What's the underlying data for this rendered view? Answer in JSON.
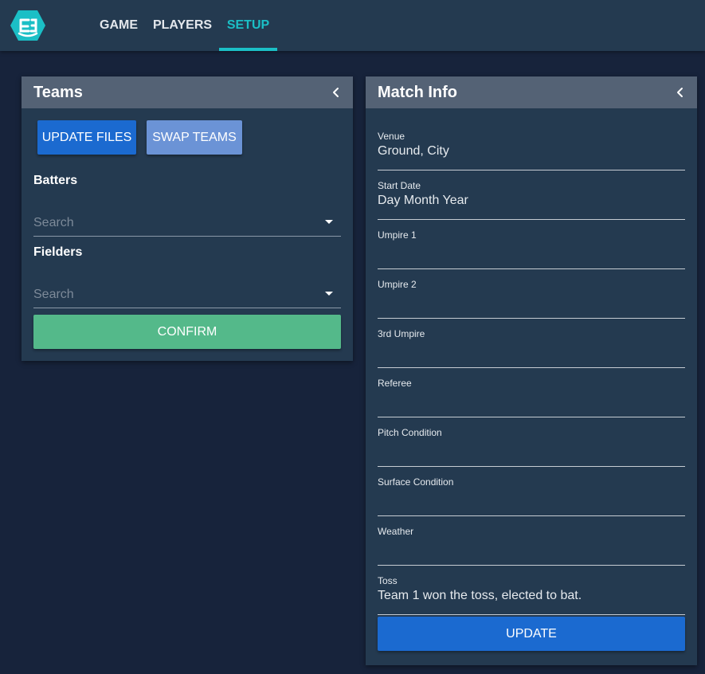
{
  "nav": {
    "tabs": [
      {
        "label": "GAME",
        "active": false
      },
      {
        "label": "PLAYERS",
        "active": false
      },
      {
        "label": "SETUP",
        "active": true
      }
    ]
  },
  "colors": {
    "accent": "#1bbfc6",
    "primary_button": "#1b6ad0",
    "secondary_button": "#6b93d6",
    "confirm_button": "#54b98a",
    "panel_header": "#546275",
    "panel_body": "#243a50",
    "background": "#17233b"
  },
  "icons": {
    "logo": "logo-icon",
    "collapse": "chevron-left-icon",
    "dropdown": "caret-down-icon"
  },
  "teams_panel": {
    "title": "Teams",
    "update_files_label": "UPDATE FILES",
    "swap_teams_label": "SWAP TEAMS",
    "batters_label": "Batters",
    "batters_placeholder": "Search",
    "fielders_label": "Fielders",
    "fielders_placeholder": "Search",
    "confirm_label": "CONFIRM"
  },
  "match_panel": {
    "title": "Match Info",
    "fields": [
      {
        "label": "Venue",
        "value": "Ground, City"
      },
      {
        "label": "Start Date",
        "value": "Day Month Year"
      },
      {
        "label": "Umpire 1",
        "value": ""
      },
      {
        "label": "Umpire 2",
        "value": ""
      },
      {
        "label": "3rd Umpire",
        "value": ""
      },
      {
        "label": "Referee",
        "value": ""
      },
      {
        "label": "Pitch Condition",
        "value": ""
      },
      {
        "label": "Surface Condition",
        "value": ""
      },
      {
        "label": "Weather",
        "value": ""
      },
      {
        "label": "Toss",
        "value": "Team 1 won the toss, elected to bat."
      }
    ],
    "update_label": "UPDATE"
  }
}
